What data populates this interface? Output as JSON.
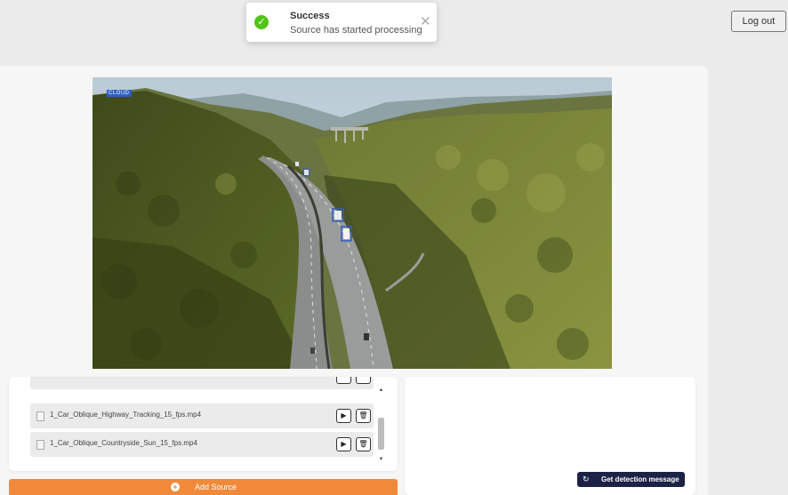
{
  "toast": {
    "title": "Success",
    "message": "Source has started processing",
    "icon": "check-circle-icon",
    "close_icon": "close-icon"
  },
  "header": {
    "logout_label": "Log out"
  },
  "video": {
    "overlay_tag": "CLOUD",
    "colors": {
      "sky": "#c9d6de",
      "forest": "#4f5c25",
      "road": "#8b8d8c",
      "detection_box": "#2f5ec4"
    }
  },
  "sources": {
    "files": [
      {
        "name": "1_Car_Oblique_Highway_Tracking_15_fps.mp4"
      },
      {
        "name": "1_Car_Oblique_Countryside_Sun_15_fps.mp4"
      }
    ],
    "play_icon": "play-icon",
    "delete_icon": "trash-icon",
    "add_source_label": "Add Source"
  },
  "detection": {
    "button_label": "Get detection message",
    "icon": "refresh-icon"
  },
  "colors": {
    "accent_orange": "#f08a3a",
    "navy_button": "#1c2245",
    "success_green": "#52c41a"
  }
}
